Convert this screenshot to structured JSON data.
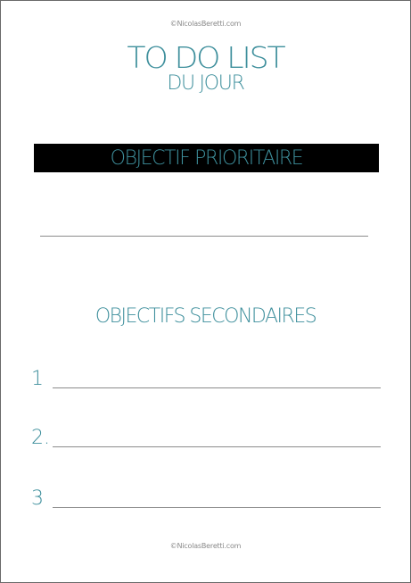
{
  "copyright": "©NicolasBeretti.com",
  "title": {
    "main": "TO DO LIST",
    "sub": "DU JOUR"
  },
  "priority": {
    "heading": "OBJECTIF PRIORITAIRE"
  },
  "secondary": {
    "heading": "OBJECTIFS SECONDAIRES",
    "items": [
      {
        "number": "1"
      },
      {
        "number": "2."
      },
      {
        "number": "3"
      }
    ]
  },
  "colors": {
    "accent": "#3e8f9c",
    "banner": "#000000",
    "line": "#8c8c8c",
    "copyright_text": "#8a8a8a"
  }
}
